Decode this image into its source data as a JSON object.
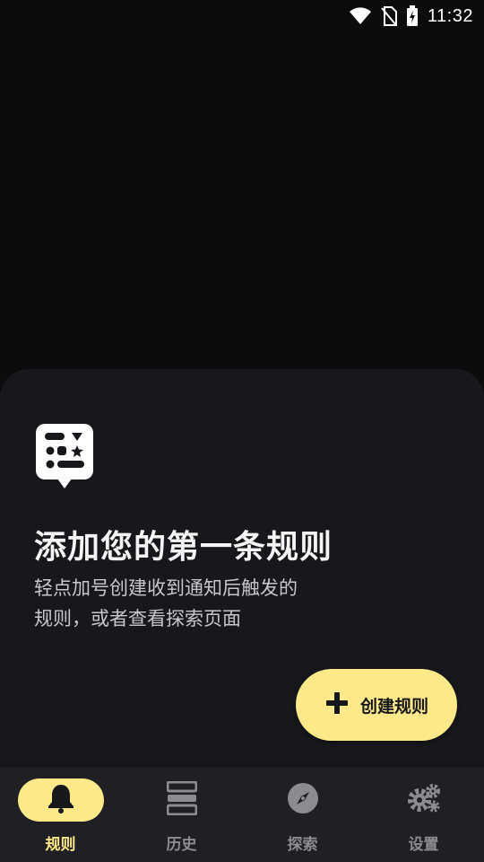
{
  "status_bar": {
    "time": "11:32",
    "icons": [
      "wifi-icon",
      "no-sim-icon",
      "battery-charging-icon"
    ]
  },
  "empty_state": {
    "icon": "rules-panel-icon",
    "title": "添加您的第一条规则",
    "description": "轻点加号创建收到通知后触发的规则，或者查看探索页面"
  },
  "fab": {
    "icon": "plus-icon",
    "label": "创建规则"
  },
  "nav": {
    "items": [
      {
        "label": "规则",
        "icon": "bell-icon",
        "active": true
      },
      {
        "label": "历史",
        "icon": "history-icon",
        "active": false
      },
      {
        "label": "探索",
        "icon": "compass-icon",
        "active": false
      },
      {
        "label": "设置",
        "icon": "gears-icon",
        "active": false
      }
    ]
  },
  "colors": {
    "accent": "#fde98a",
    "background": "#0b0c0e",
    "sheet": "#17181c",
    "nav_background": "#1f2024",
    "nav_inactive": "#8b8c90"
  }
}
